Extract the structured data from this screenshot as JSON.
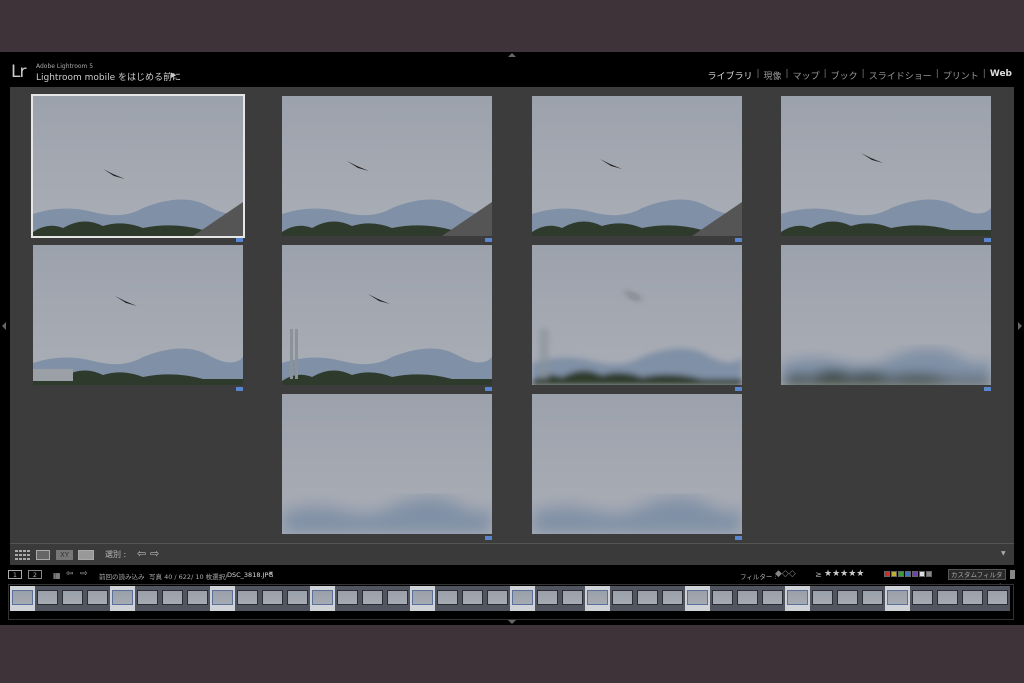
{
  "header": {
    "logo": "Lr",
    "product": "Adobe Lightroom 5",
    "identity_plate": "Lightroom mobile をはじめる前に",
    "identity_arrow": "▶"
  },
  "modules": [
    {
      "label": "ライブラリ",
      "active": true
    },
    {
      "label": "現像"
    },
    {
      "label": "マップ"
    },
    {
      "label": "ブック"
    },
    {
      "label": "スライドショー"
    },
    {
      "label": "プリント"
    },
    {
      "label": "Web"
    }
  ],
  "grid": {
    "photos": [
      {
        "selected": true
      },
      {},
      {},
      {},
      {},
      {},
      {},
      {},
      {},
      {}
    ]
  },
  "toolbar": {
    "sort_label": "選別 :",
    "menu_arrow": "▼"
  },
  "filmstrip_bar": {
    "screen1": "1",
    "screen2": "2",
    "source": "前回の読み込み",
    "count": "写真 40 / 622/ 10 枚選択/",
    "filename": "DSC_3818.JPG",
    "filename_arrow": "▼",
    "filter_label": "フィルター :",
    "rating_op": "≥",
    "stars": "★★★★★",
    "custom_filter": "カスタムフィルター",
    "custom_arrow": "÷"
  },
  "filmstrip": {
    "count": 40,
    "highlighted": [
      0,
      4,
      8,
      12,
      16,
      20,
      23,
      27,
      31,
      35
    ]
  },
  "colors": {
    "accent_badge": "#5a86d0",
    "label_colors": [
      "#c03030",
      "#c0b030",
      "#30a030",
      "#4070c0",
      "#7040b0",
      "#dddddd",
      "#888888"
    ]
  }
}
